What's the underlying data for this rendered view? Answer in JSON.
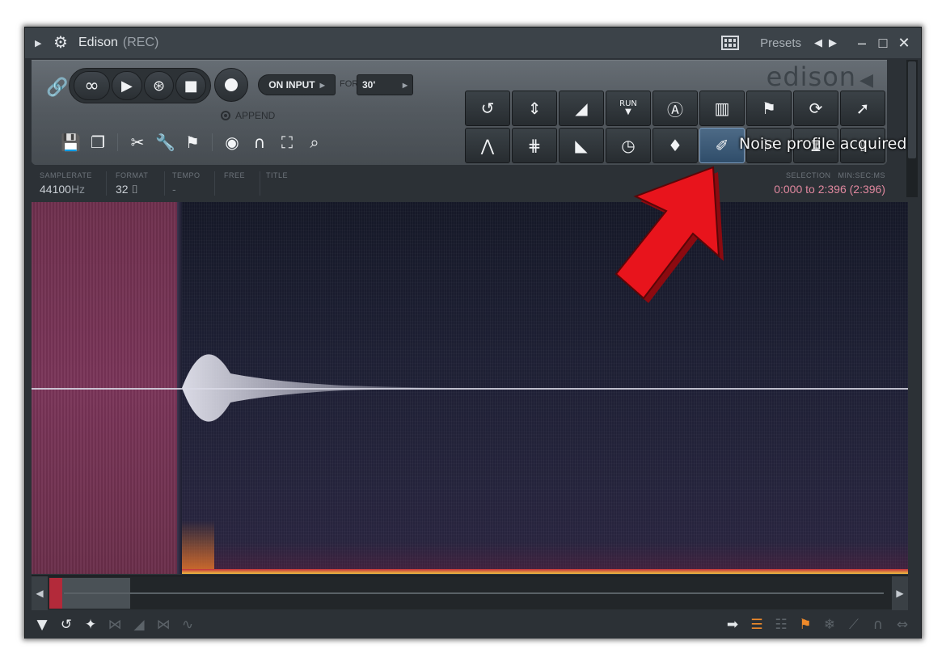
{
  "window": {
    "title": "Edison",
    "title_suffix": "(REC)",
    "presets_label": "Presets"
  },
  "toolbar": {
    "on_input_label": "ON INPUT",
    "for_label": "FOR",
    "for_value": "30'",
    "append_label": "APPEND",
    "logo_text": "edison"
  },
  "tooltip": "Noise profile acquired",
  "info": {
    "samplerate_label": "SAMPLERATE",
    "samplerate_value": "44100",
    "samplerate_unit": "Hz",
    "format_label": "FORMAT",
    "format_value": "32",
    "tempo_label": "TEMPO",
    "tempo_value": "-",
    "free_label": "FREE",
    "title_label": "TITLE",
    "selection_label": "SELECTION",
    "time_format_label": "MIN:SEC:MS",
    "selection_value": "0:000 to 2:396 (2:396)"
  },
  "run_label": "RUN",
  "colors": {
    "accent_active": "#4d6a86",
    "selection_text": "#e1889f",
    "annotation_arrow": "#e8141c"
  }
}
